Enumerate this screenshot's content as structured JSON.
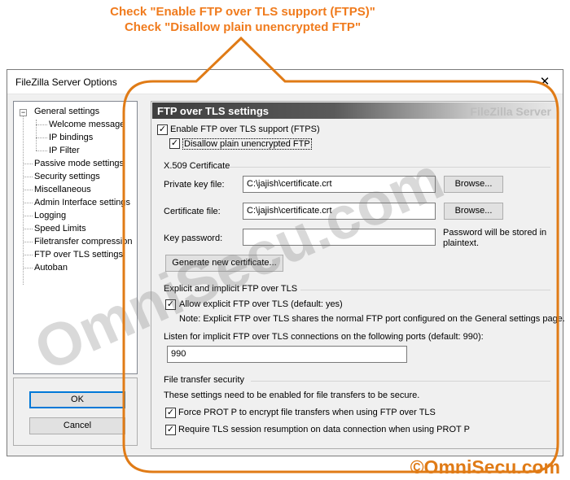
{
  "annotation": {
    "line1": "Check \"Enable FTP over TLS support (FTPS)\"",
    "line2": "Check \"Disallow plain unencrypted FTP\""
  },
  "window": {
    "title": "FileZilla Server Options",
    "close_glyph": "✕"
  },
  "tree": {
    "items": [
      {
        "label": "General settings",
        "expander": "−"
      },
      {
        "label": "Welcome message"
      },
      {
        "label": "IP bindings"
      },
      {
        "label": "IP Filter"
      },
      {
        "label": "Passive mode settings"
      },
      {
        "label": "Security settings"
      },
      {
        "label": "Miscellaneous"
      },
      {
        "label": "Admin Interface settings"
      },
      {
        "label": "Logging"
      },
      {
        "label": "Speed Limits"
      },
      {
        "label": "Filetransfer compression"
      },
      {
        "label": "FTP over TLS settings",
        "selected": true
      },
      {
        "label": "Autoban"
      }
    ]
  },
  "buttons": {
    "ok": "OK",
    "cancel": "Cancel"
  },
  "panel": {
    "title": "FTP over TLS settings",
    "brand": "FileZilla Server",
    "enable_ftps": {
      "label": "Enable FTP over TLS support (FTPS)",
      "checked": true
    },
    "disallow_plain": {
      "label": "Disallow plain unencrypted FTP",
      "checked": true
    },
    "x509": {
      "group_label": "X.509 Certificate",
      "private_key_label": "Private key file:",
      "private_key_value": "C:\\jajish\\certificate.crt",
      "certificate_label": "Certificate file:",
      "certificate_value": "C:\\jajish\\certificate.crt",
      "browse_label": "Browse...",
      "key_password_label": "Key password:",
      "key_password_value": "",
      "password_note_line1": "Password will be stored in",
      "password_note_line2": "plaintext.",
      "generate_label": "Generate new certificate..."
    },
    "explicit": {
      "group_label": "Explicit and implicit FTP over TLS",
      "allow_explicit_label": "Allow explicit FTP over TLS (default: yes)",
      "allow_explicit_checked": true,
      "note": "Note: Explicit FTP over TLS shares the normal FTP port configured on the General settings page.",
      "implicit_ports_label": "Listen for implicit FTP over TLS connections on the following ports (default: 990):",
      "implicit_ports_value": "990"
    },
    "security": {
      "group_label": "File transfer security",
      "description": "These settings need to be enabled for file transfers to be secure.",
      "force_prot_label": "Force PROT P to encrypt file transfers when using FTP over TLS",
      "force_prot_checked": true,
      "require_resumption_label": "Require TLS session resumption on data connection when using PROT P",
      "require_resumption_checked": true
    }
  },
  "watermark": "OmniSecu.com",
  "copyright": "©OmniSecu.com",
  "colors": {
    "annotation": "#f07b1d",
    "copyright": "#e07b16",
    "accent": "#0078d7"
  }
}
